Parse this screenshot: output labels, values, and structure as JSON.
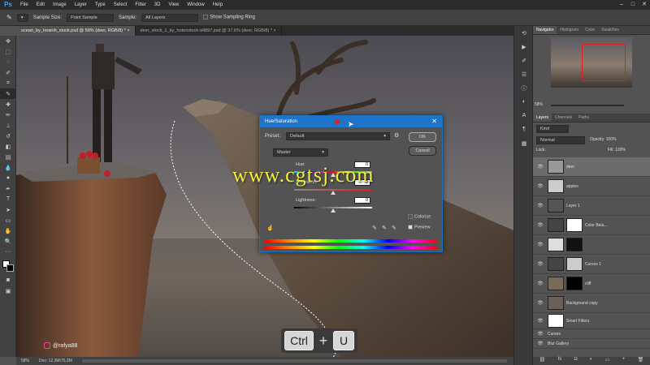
{
  "app": {
    "logo": "Ps"
  },
  "menu": [
    "File",
    "Edit",
    "Image",
    "Layer",
    "Type",
    "Select",
    "Filter",
    "3D",
    "View",
    "Window",
    "Help"
  ],
  "options": {
    "sample_size_label": "Sample Size:",
    "sample_size_value": "Point Sample",
    "sample_label": "Sample:",
    "sample_value": "All Layers",
    "show_ring_label": "Show Sampling Ring"
  },
  "tabs": [
    {
      "label": "ocean_by_toranih_stock.psd @ 58% (deer, RGB/8) *"
    },
    {
      "label": "deer_stock_1_by_hotenstock-d4897.psd @ 37.6% (deer, RGB/8) *"
    }
  ],
  "status": {
    "zoom": "58%",
    "doc": "Doc: 12.3M/76.3M"
  },
  "panels": {
    "top_tabs": [
      "Navigator",
      "Histogram",
      "Color",
      "Swatches"
    ],
    "nav_zoom": "58%",
    "layer_tabs": [
      "Layers",
      "Channels",
      "Paths"
    ],
    "kind_label": "Kind",
    "blend_mode": "Normal",
    "opacity_label": "Opacity:",
    "opacity_value": "100%",
    "lock_label": "Lock:",
    "fill_label": "Fill:",
    "fill_value": "100%",
    "layers": [
      {
        "name": "deer"
      },
      {
        "name": "apples"
      },
      {
        "name": "Layer 1"
      },
      {
        "name": "Color Bala..."
      },
      {
        "name": ""
      },
      {
        "name": "Curves 1"
      },
      {
        "name": "cliff"
      },
      {
        "name": "Background copy"
      },
      {
        "name": "Smart Filters"
      },
      {
        "name": "Curves"
      },
      {
        "name": "Blur Gallery"
      }
    ]
  },
  "dialog": {
    "title": "Hue/Saturation",
    "preset_label": "Preset:",
    "preset_value": "Default",
    "ok": "OK",
    "cancel": "Cancel",
    "channel": "Master",
    "hue_label": "Hue:",
    "hue_value": "0",
    "saturation_label": "Saturation:",
    "saturation_value": "0",
    "lightness_label": "Lightness:",
    "lightness_value": "0",
    "colorize_label": "Colorize",
    "preview_label": "Preview"
  },
  "overlay": {
    "watermark": "www.cgtsj.com",
    "handle": "@rafya88",
    "key_ctrl": "Ctrl",
    "key_plus": "+",
    "key_u": "U"
  },
  "colors": {
    "accent": "#1e74c8",
    "selection": "#e02020",
    "watermark": "#f0ef3c"
  }
}
